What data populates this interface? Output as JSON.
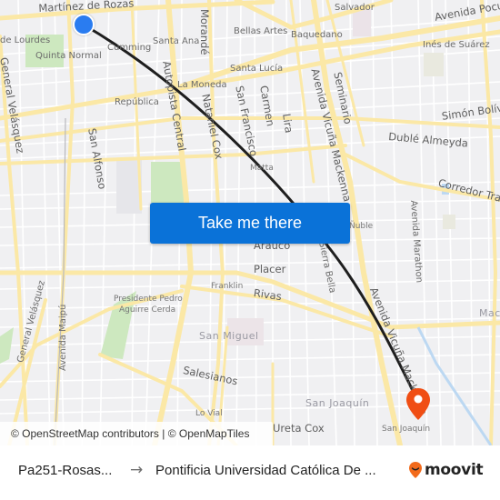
{
  "map": {
    "labels": {
      "martinez_de_rozas": "Martínez de Rozas",
      "salvador": "Salvador",
      "avenida_pocuro": "Avenida Pocuro",
      "lourdes": "de Lourdes",
      "quinta_normal": "Quinta Normal",
      "cumming": "Cumming",
      "santa_ana": "Santa Ana",
      "morande": "Morandé",
      "bellas_artes": "Bellas Artes",
      "baquedano": "Baquedano",
      "ines_de_suarez": "Inés de Suárez",
      "santa_lucia": "Santa Lucía",
      "la_moneda": "La Moneda",
      "republica": "República",
      "autopista_central": "Autopista Central",
      "nataniel_cox": "Nataniel Cox",
      "san_francisco": "San Francisco",
      "carmen": "Carmen",
      "lira": "Lira",
      "avenida_vicuna_mackenna": "Avenida Vicuña Mackenna",
      "seminario": "Seminario",
      "simon_bolivar": "Simón Bolívar",
      "duble_almeyda": "Dublé Almeyda",
      "general_velasquez": "General Velásquez",
      "san_alfonso": "San Alfonso",
      "matta": "Matta",
      "corredor": "Corredor Tran",
      "nuble": "Ñuble",
      "avenida_marathon": "Avenida Marathon",
      "arauco": "Arauco",
      "placer": "Placer",
      "sierra_bella": "Sierra Bella",
      "franklin": "Franklin",
      "rivas": "Rivas",
      "presidente_pedro": "Presidente Pedro",
      "aguirre_cerda": "Aguirre Cerda",
      "avenida_maipu": "Avenida Maipú",
      "san_miguel": "San Miguel",
      "macul": "Macul",
      "avenida_vicuna_mackenna_south": "Avenida Vicuña Mackenna",
      "salesianos": "Salesianos",
      "lo_vial": "Lo Vial",
      "san_joaquin_district": "San Joaquín",
      "ureta_cox": "Ureta Cox",
      "san_joaquin_station": "San Joaquín"
    },
    "attribution": "© OpenStreetMap contributors | © OpenMapTiles",
    "take_me_there": "Take me there",
    "colors": {
      "route": "#1e1e1e",
      "origin": "#2a7cf0",
      "destination": "#f04e14",
      "button": "#0a72d8",
      "road_major": "#fbe8a6",
      "park": "#cde8bf"
    }
  },
  "footer": {
    "from": "Pa251-Rosas...",
    "arrow": "→",
    "to": "Pontificia Universidad Católica De ...",
    "brand": "moovit"
  }
}
